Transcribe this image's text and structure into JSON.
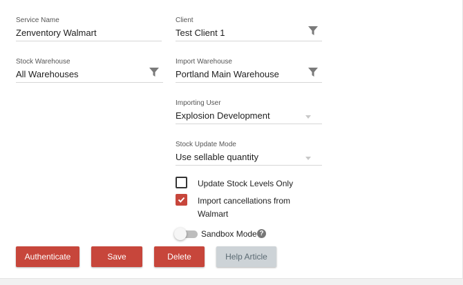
{
  "form": {
    "service_name": {
      "label": "Service Name",
      "value": "Zenventory Walmart"
    },
    "client": {
      "label": "Client",
      "value": "Test Client 1",
      "icon": "filter-icon"
    },
    "stock_warehouse": {
      "label": "Stock Warehouse",
      "value": "All Warehouses",
      "icon": "filter-icon"
    },
    "import_warehouse": {
      "label": "Import Warehouse",
      "value": "Portland Main Warehouse",
      "icon": "filter-icon"
    },
    "importing_user": {
      "label": "Importing User",
      "value": "Explosion Development",
      "icon": "dropdown-caret"
    },
    "stock_update_mode": {
      "label": "Stock Update Mode",
      "value": "Use sellable quantity",
      "icon": "dropdown-caret"
    },
    "update_stock_only": {
      "label": "Update Stock Levels Only",
      "checked": false
    },
    "import_cancellations": {
      "label_line1": "Import cancellations from",
      "label_line2": "Walmart",
      "checked": true
    },
    "sandbox_mode": {
      "label": "Sandbox Mode",
      "enabled": false,
      "help_glyph": "?"
    }
  },
  "buttons": {
    "authenticate": "Authenticate",
    "save": "Save",
    "delete": "Delete",
    "help_article": "Help Article"
  },
  "colors": {
    "primary": "#c7463b",
    "secondary_button": "#cdd3d7",
    "secondary_text": "#5b6a73",
    "underline": "#d6d6d6",
    "filter_icon": "#7a7a7a"
  }
}
